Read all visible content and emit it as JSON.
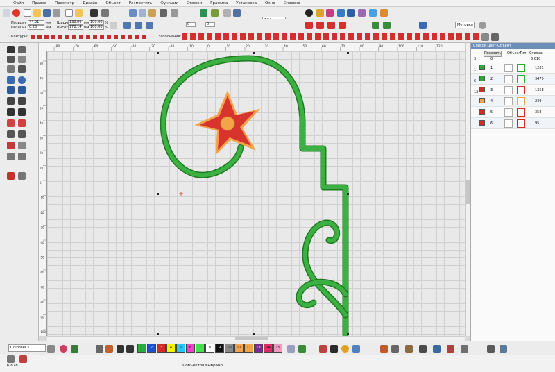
{
  "menu": [
    "Файл",
    "Правка",
    "Просмотр",
    "Дизайн",
    "Объект",
    "Разместить",
    "Функции",
    "Стежки",
    "Графика",
    "Установка",
    "Окно",
    "Справка"
  ],
  "toolbar": {
    "zoom_value": "124",
    "units": "Метрика"
  },
  "position": {
    "x_label": "Позиция X:",
    "x_value": "44.91",
    "y_label": "Позиция Y:",
    "y_value": "0.26",
    "width_label": "Ширина",
    "width_value": "139.99",
    "height_label": "Высота",
    "height_value": "172.14",
    "unit_mm": "мм",
    "pct_w": "100.00",
    "pct_h": "100.00",
    "unit_pct": "%",
    "angle1": "0",
    "angle2": "0"
  },
  "styles_bar": {
    "outlines_label": "Контуры:",
    "fills_label": "Заполнения:"
  },
  "ruler_h_ticks": [
    "-80",
    "-70",
    "-60",
    "-50",
    "-40",
    "-30",
    "-20",
    "-10",
    "0",
    "10",
    "20",
    "30",
    "40",
    "50",
    "60",
    "70",
    "80",
    "90",
    "100",
    "110",
    "120"
  ],
  "ruler_v_ticks": [
    "80",
    "70",
    "60",
    "50",
    "40",
    "30",
    "20",
    "10",
    "0",
    "-10",
    "-20",
    "-30",
    "-40",
    "-50",
    "-60",
    "-70",
    "-80",
    "-90",
    "-100"
  ],
  "panel": {
    "title": "Список Цвет-Объект",
    "show_button": "Показать",
    "col_object": "Объект",
    "col_type": "Тип",
    "col_stitches": "Стежки",
    "header_count": "6 010",
    "header_zero": "0",
    "rows": [
      {
        "num": "1",
        "count": "1281",
        "color": "#2ea836"
      },
      {
        "num": "2",
        "count": "3479",
        "color": "#2ea836"
      },
      {
        "num": "3",
        "count": "1358",
        "color": "#d42a2a"
      },
      {
        "num": "4",
        "count": "239",
        "color": "#f3a44a"
      },
      {
        "num": "5",
        "count": "358",
        "color": "#d42a2a"
      },
      {
        "num": "6",
        "count": "95",
        "color": "#d42a2a"
      }
    ],
    "group_labels": [
      "3",
      "1",
      "6",
      "12"
    ]
  },
  "bottom": {
    "thread_chart": "Coloreel 1",
    "palette": [
      {
        "n": "1",
        "c": "#2ea836"
      },
      {
        "n": "2",
        "c": "#1b4fd0"
      },
      {
        "n": "3",
        "c": "#d42a2a"
      },
      {
        "n": "4",
        "c": "#f4f400"
      },
      {
        "n": "5",
        "c": "#25c8f0"
      },
      {
        "n": "6",
        "c": "#f040d0"
      },
      {
        "n": "7",
        "c": "#48e048"
      },
      {
        "n": "8",
        "c": "#ffffff"
      },
      {
        "n": "9",
        "c": "#111111"
      },
      {
        "n": "10",
        "c": "#8a8a8a"
      },
      {
        "n": "11",
        "c": "#f3a44a"
      },
      {
        "n": "12",
        "c": "#f3a44a"
      },
      {
        "n": "13",
        "c": "#7a2b8c"
      },
      {
        "n": "14",
        "c": "#e02a6a"
      },
      {
        "n": "15",
        "c": "#f09ac0"
      }
    ]
  },
  "status": {
    "zoom": "6 878",
    "selection": "6 объектов выбрано"
  }
}
